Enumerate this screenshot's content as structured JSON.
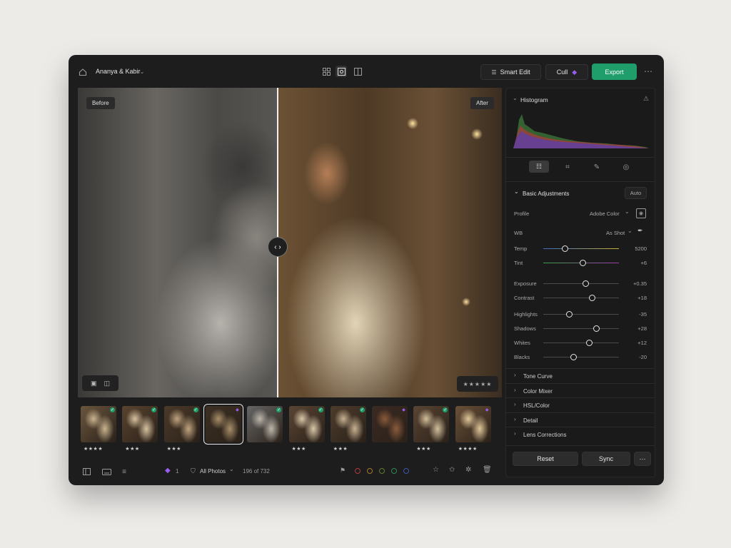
{
  "app": {
    "project_title": "Ananya & Kabir"
  },
  "toolbar": {
    "smart_edit": "Smart Edit",
    "cull": "Cull",
    "export": "Export"
  },
  "viewer": {
    "before_label": "Before",
    "after_label": "After",
    "rating": "★★★★★"
  },
  "filmstrip": [
    {
      "stars": "★★★★",
      "status": "check"
    },
    {
      "stars": "★★★",
      "status": "check"
    },
    {
      "stars": "★★★",
      "status": "check"
    },
    {
      "stars": "",
      "status": "diamond",
      "selected": true
    },
    {
      "stars": "",
      "status": "check"
    },
    {
      "stars": "★★★",
      "status": "check"
    },
    {
      "stars": "★★★",
      "status": "check"
    },
    {
      "stars": "",
      "status": "diamond"
    },
    {
      "stars": "★★★",
      "status": "check"
    },
    {
      "stars": "★★★★",
      "status": "diamond"
    }
  ],
  "bottombar": {
    "flag_count": "1",
    "filter_label": "All Photos",
    "count": "196 of 732",
    "color_labels": [
      "#b33a3a",
      "#a57a2a",
      "#5f7a2e",
      "#2e8a4e",
      "#3b55a8"
    ]
  },
  "panel": {
    "histogram_title": "Histogram",
    "basic_title": "Basic Adjustments",
    "auto": "Auto",
    "profile_label": "Profile",
    "profile_value": "Adobe Color",
    "wb_label": "WB",
    "wb_value": "As Shot",
    "sliders": [
      {
        "label": "Temp",
        "value": "5200",
        "pos": 0.28
      },
      {
        "label": "Tint",
        "value": "+6",
        "pos": 0.52
      },
      {
        "label": "Exposure",
        "value": "+0.35",
        "pos": 0.56
      },
      {
        "label": "Contrast",
        "value": "+18",
        "pos": 0.64
      },
      {
        "label": "Highlights",
        "value": "-35",
        "pos": 0.34
      },
      {
        "label": "Shadows",
        "value": "+28",
        "pos": 0.7
      },
      {
        "label": "Whites",
        "value": "+12",
        "pos": 0.6
      },
      {
        "label": "Blacks",
        "value": "-20",
        "pos": 0.4
      }
    ],
    "sections": [
      "Tone Curve",
      "Color Mixer",
      "HSL/Color",
      "Detail",
      "Lens Corrections"
    ],
    "reset": "Reset",
    "sync": "Sync"
  }
}
